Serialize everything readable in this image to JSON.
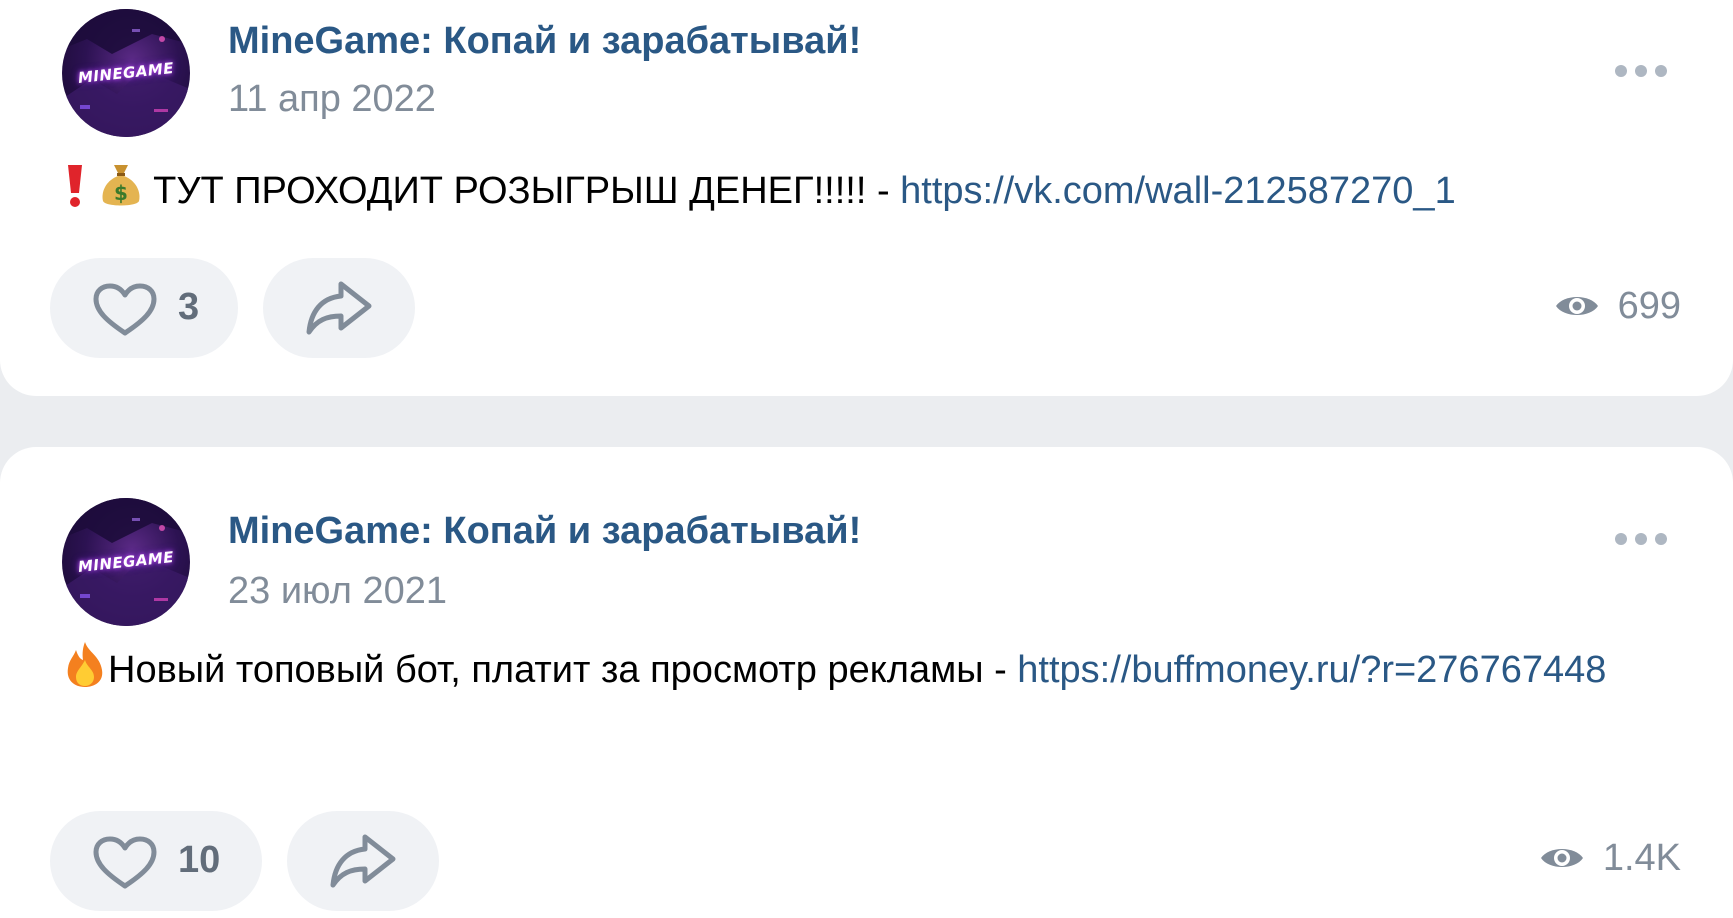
{
  "colors": {
    "background": "#ebedf0",
    "card": "#ffffff",
    "author_blue": "#2a5885",
    "link_blue": "#2a5885",
    "muted_gray": "#818c99",
    "button_bg": "#f0f2f5",
    "icon_gray": "#626d7a"
  },
  "posts": [
    {
      "avatar_text": "MINEGAME",
      "author": "MineGame: Копай и зарабатывай!",
      "date": "11 апр 2022",
      "text": "ТУТ ПРОХОДИТ РОЗЫГРЫШ ДЕНЕГ!!!!! - ",
      "link": "https://vk.com/wall-212587270_1",
      "emojis": [
        "exclamation-icon",
        "money-bag-icon"
      ],
      "likes": "3",
      "views": "699",
      "icons": [
        "more-icon",
        "heart-icon",
        "share-icon",
        "eye-icon"
      ]
    },
    {
      "avatar_text": "MINEGAME",
      "author": "MineGame: Копай и зарабатывай!",
      "date": "23 июл 2021",
      "text": "Новый топовый бот, платит за просмотр рекламы - ",
      "link": "https://buffmoney.ru/?r=276767448",
      "emojis": [
        "fire-icon"
      ],
      "likes": "10",
      "views": "1.4K",
      "icons": [
        "more-icon",
        "heart-icon",
        "share-icon",
        "eye-icon"
      ]
    }
  ]
}
